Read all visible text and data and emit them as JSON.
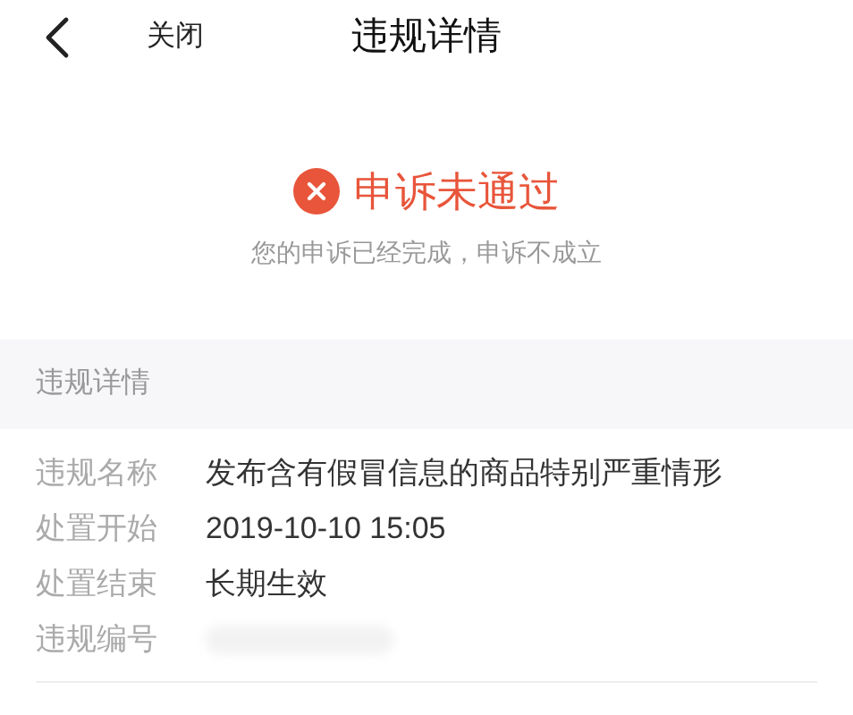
{
  "nav": {
    "close": "关闭",
    "title": "违规详情"
  },
  "status": {
    "kind": "rejected",
    "title": "申诉未通过",
    "message": "您的申诉已经完成，申诉不成立"
  },
  "section": {
    "title": "违规详情"
  },
  "rows": [
    {
      "label": "违规名称",
      "value": "发布含有假冒信息的商品特别严重情形"
    },
    {
      "label": "处置开始",
      "value": "2019-10-10 15:05"
    },
    {
      "label": "处置结束",
      "value": "长期生效"
    },
    {
      "label": "违规编号",
      "redacted": true
    }
  ]
}
